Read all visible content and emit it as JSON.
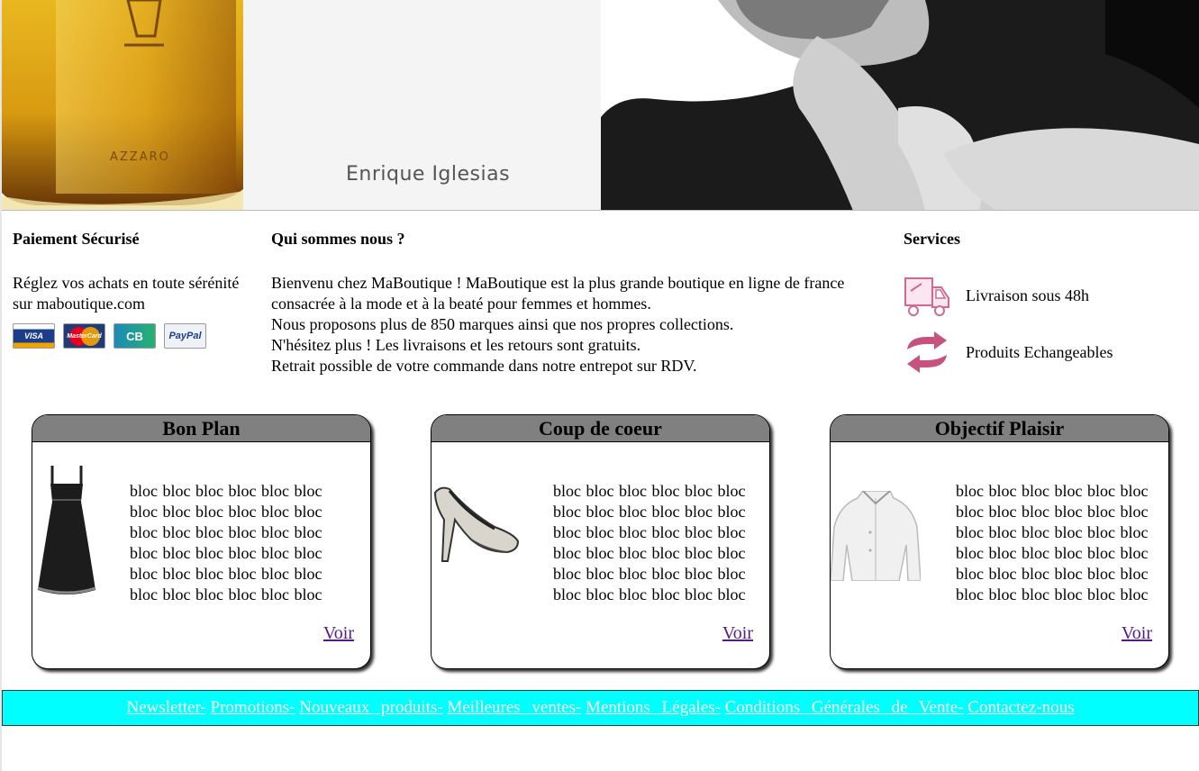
{
  "banner": {
    "caption": "Enrique Iglesias",
    "perfume_label": "AZZARO"
  },
  "payment": {
    "title": "Paiement Sécurisé",
    "text": "Réglez vos achats en toute sérénité sur maboutique.com",
    "cards": [
      "VISA",
      "MasterCard",
      "CB",
      "PayPal"
    ]
  },
  "about": {
    "title": "Qui sommes nous ?",
    "lines": [
      "Bienvenu chez MaBoutique ! MaBoutique est la plus grande boutique en ligne de france",
      "consacrée à la mode et à la beaté pour femmes et hommes.",
      "Nous proposons plus de 850 marques ainsi que nos propres collections.",
      "N'hésitez plus ! Les livraisons et les retours sont gratuits.",
      "Retrait possible de votre commande dans notre entrepot sur RDV."
    ]
  },
  "services": {
    "title": "Services",
    "items": [
      {
        "label": "Livraison sous 48h",
        "icon": "delivery-truck-icon"
      },
      {
        "label": "Produits Echangeables",
        "icon": "exchange-arrows-icon"
      }
    ]
  },
  "boxes": [
    {
      "title": "Bon Plan",
      "text": "bloc bloc bloc bloc bloc bloc bloc bloc bloc bloc bloc bloc bloc bloc bloc bloc bloc bloc bloc bloc bloc bloc bloc bloc bloc bloc bloc bloc bloc bloc bloc bloc bloc bloc bloc bloc",
      "link": "Voir",
      "image": "black-dress"
    },
    {
      "title": "Coup de coeur",
      "text": "bloc bloc bloc bloc bloc bloc bloc bloc bloc bloc bloc bloc bloc bloc bloc bloc bloc bloc bloc bloc bloc bloc bloc bloc bloc bloc bloc bloc bloc bloc bloc bloc bloc bloc bloc bloc",
      "link": "Voir",
      "image": "high-heel-shoe"
    },
    {
      "title": "Objectif Plaisir",
      "text": "bloc bloc bloc bloc bloc bloc bloc bloc bloc bloc bloc bloc bloc bloc bloc bloc bloc bloc bloc bloc bloc bloc bloc bloc bloc bloc bloc bloc bloc bloc bloc bloc bloc bloc bloc bloc",
      "link": "Voir",
      "image": "white-shirt"
    }
  ],
  "footer": {
    "links": [
      "Newsletter-",
      "Promotions-",
      "Nouveaux produits-",
      "Meilleures ventes-",
      "Mentions Légales-",
      "Conditions Générales de Vente-",
      "Contactez-nous"
    ]
  },
  "colors": {
    "footer_bg": "#00ffff",
    "box_header": "#808080",
    "link_visited": "#551a8b"
  }
}
